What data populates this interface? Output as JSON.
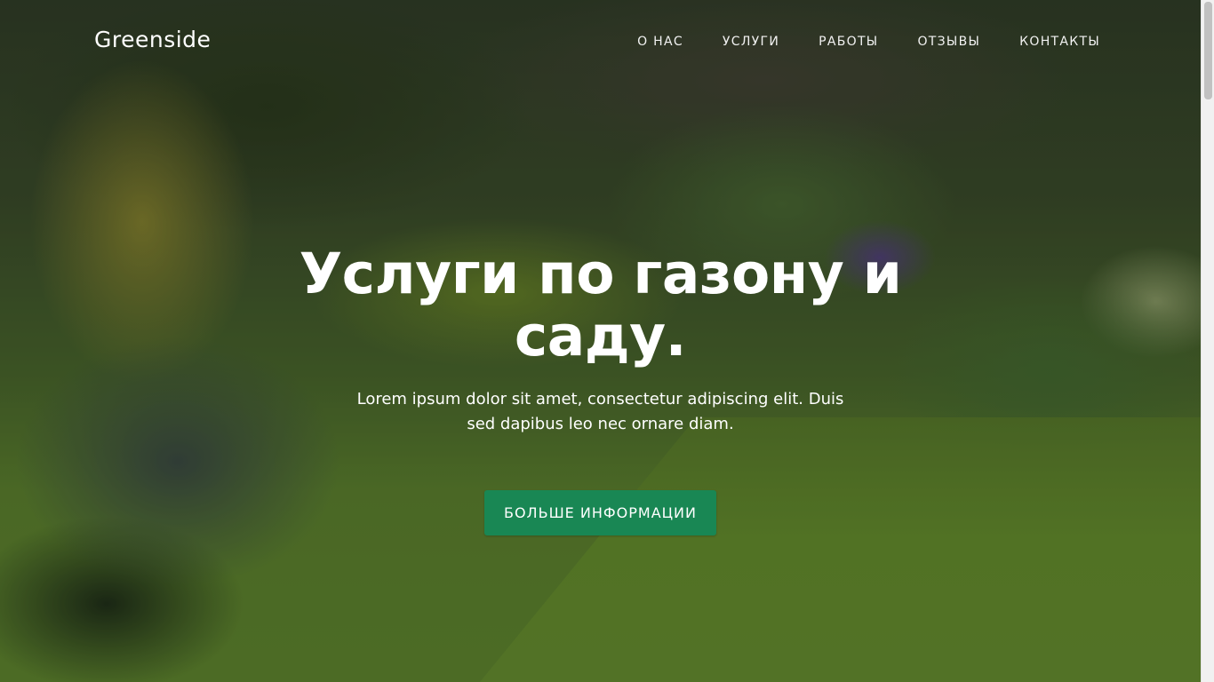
{
  "navbar": {
    "brand": "Greenside",
    "links": [
      "О НАС",
      "УСЛУГИ",
      "РАБОТЫ",
      "ОТЗЫВЫ",
      "КОНТАКТЫ"
    ]
  },
  "hero": {
    "title": "Услуги по газону и саду.",
    "subtitle": "Lorem ipsum dolor sit amet, consectetur adipiscing elit. Duis sed dapibus leo nec ornare diam.",
    "cta_label": "БОЛЬШЕ ИНФОРМАЦИИ"
  },
  "colors": {
    "cta_background": "#198754",
    "text": "#ffffff"
  }
}
